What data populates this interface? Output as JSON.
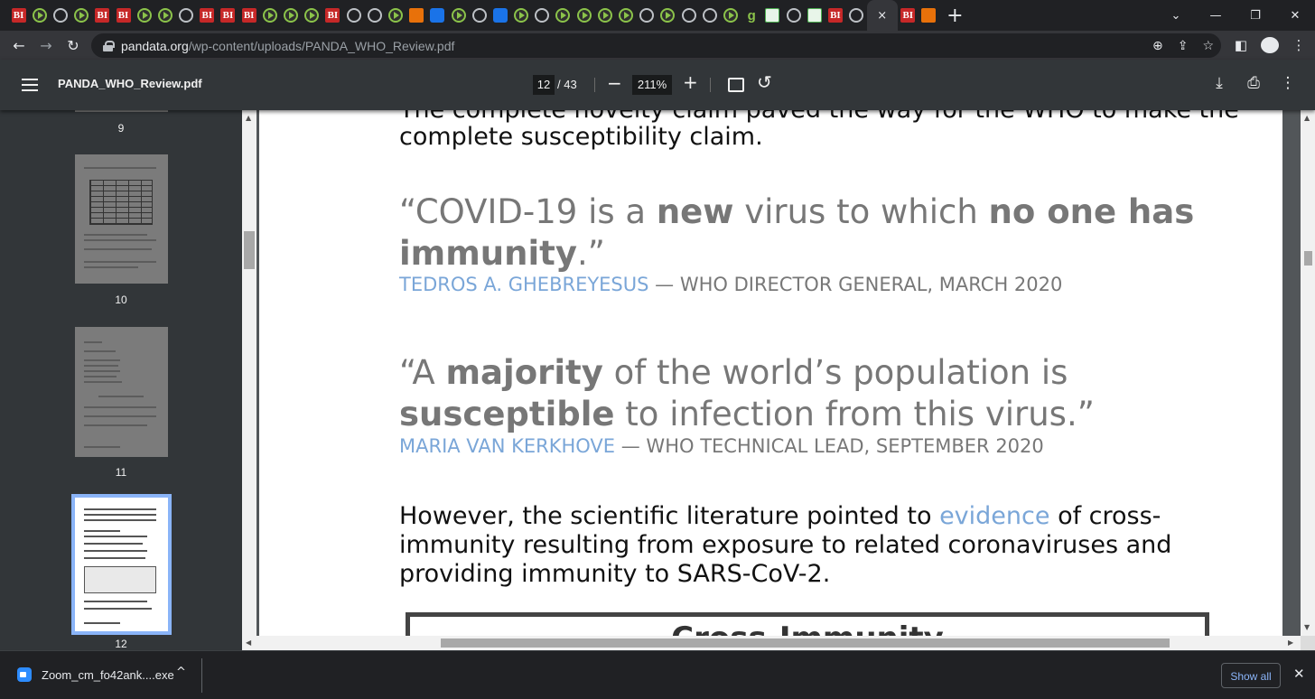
{
  "browser": {
    "tabs": [
      {
        "icon": "bi-icon",
        "glyph": "BI"
      },
      {
        "icon": "play-icon",
        "glyph": ""
      },
      {
        "icon": "globe-icon",
        "glyph": ""
      },
      {
        "icon": "play-icon",
        "glyph": ""
      },
      {
        "icon": "bi-icon",
        "glyph": "BI"
      },
      {
        "icon": "bi-icon",
        "glyph": "BI"
      },
      {
        "icon": "play-icon",
        "glyph": ""
      },
      {
        "icon": "play-icon",
        "glyph": ""
      },
      {
        "icon": "globe-icon",
        "glyph": ""
      },
      {
        "icon": "bi-icon",
        "glyph": "BI"
      },
      {
        "icon": "bi-icon",
        "glyph": "BI"
      },
      {
        "icon": "bi-icon",
        "glyph": "BI"
      },
      {
        "icon": "play-icon",
        "glyph": ""
      },
      {
        "icon": "play-icon",
        "glyph": ""
      },
      {
        "icon": "play-icon",
        "glyph": ""
      },
      {
        "icon": "bi-icon",
        "glyph": "BI"
      },
      {
        "icon": "globe-icon",
        "glyph": ""
      },
      {
        "icon": "globe-icon",
        "glyph": ""
      },
      {
        "icon": "play-icon",
        "glyph": ""
      },
      {
        "icon": "substack-icon",
        "glyph": ""
      },
      {
        "icon": "blue-icon",
        "glyph": ""
      },
      {
        "icon": "play-icon",
        "glyph": ""
      },
      {
        "icon": "globe-icon",
        "glyph": ""
      },
      {
        "icon": "blue-icon",
        "glyph": ""
      },
      {
        "icon": "play-icon",
        "glyph": ""
      },
      {
        "icon": "globe-icon",
        "glyph": ""
      },
      {
        "icon": "play-icon",
        "glyph": ""
      },
      {
        "icon": "play-icon",
        "glyph": ""
      },
      {
        "icon": "play-icon",
        "glyph": ""
      },
      {
        "icon": "play-icon",
        "glyph": ""
      },
      {
        "icon": "globe-icon",
        "glyph": ""
      },
      {
        "icon": "play-icon",
        "glyph": ""
      },
      {
        "icon": "globe-icon",
        "glyph": ""
      },
      {
        "icon": "globe-icon",
        "glyph": ""
      },
      {
        "icon": "play-icon",
        "glyph": ""
      },
      {
        "icon": "g-icon",
        "glyph": "g"
      },
      {
        "icon": "grid-icon",
        "glyph": ""
      },
      {
        "icon": "globe-icon",
        "glyph": ""
      },
      {
        "icon": "grid-icon",
        "glyph": ""
      },
      {
        "icon": "bi-icon",
        "glyph": "BI"
      },
      {
        "icon": "globe-icon",
        "glyph": ""
      },
      {
        "icon": "bi-icon",
        "glyph": "BI"
      },
      {
        "icon": "substack-icon",
        "glyph": ""
      }
    ],
    "active_tab_close": "×",
    "new_tab": "+",
    "url_host": "pandata.org",
    "url_path": "/wp-content/uploads/PANDA_WHO_Review.pdf"
  },
  "pdf": {
    "filename": "PANDA_WHO_Review.pdf",
    "current_page": "12",
    "total_pages": "/ 43",
    "zoom": "211%",
    "thumbnails": [
      {
        "num": "9"
      },
      {
        "num": "10"
      },
      {
        "num": "11"
      },
      {
        "num": "12"
      }
    ]
  },
  "content": {
    "top_para_line1": "The complete novelty claim paved the way for the WHO to make the",
    "top_para_line2": "complete susceptibility claim.",
    "quote1": {
      "line1_a": "“COVID-19 is a ",
      "line1_b": "new",
      "line1_c": " virus to which ",
      "line1_d": "no one has",
      "line2_a": "immunity",
      "line2_b": ".”",
      "attr_name": "TEDROS A. GHEBREYESUS",
      "attr_rest": " — WHO DIRECTOR GENERAL, MARCH 2020"
    },
    "quote2": {
      "line1_a": "“A ",
      "line1_b": "majority",
      "line1_c": " of the world’s population is",
      "line2_a": "susceptible",
      "line2_b": " to infection from this virus.”",
      "attr_name": "MARIA VAN KERKHOVE",
      "attr_rest": " — WHO TECHNICAL LEAD, SEPTEMBER 2020"
    },
    "para2": {
      "l1_a": "However, the scientific literature pointed to ",
      "l1_link": "evidence",
      "l1_b": " of cross-",
      "l2": "immunity resulting from exposure to related coronaviruses and",
      "l3": "providing immunity to SARS-CoV-2."
    },
    "box_title": "Cross-Immunity"
  },
  "download": {
    "filename": "Zoom_cm_fo42ank....exe",
    "show_all": "Show all"
  }
}
